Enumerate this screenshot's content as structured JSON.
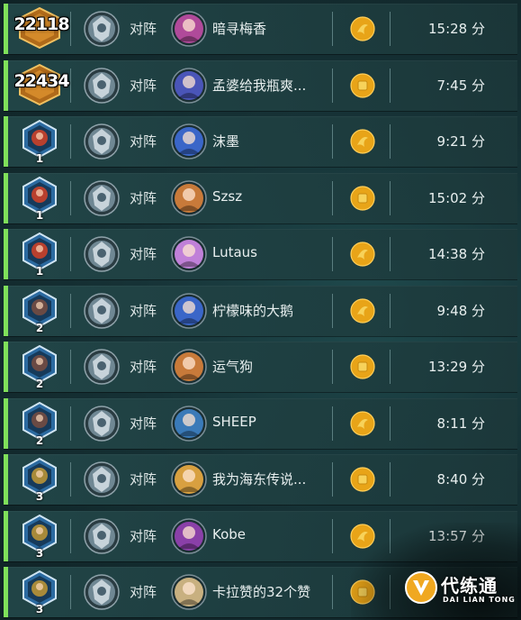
{
  "vs_label": "对阵",
  "matches": [
    {
      "rank_type": "legend",
      "rank_value": "22118",
      "opponent": "暗寻梅香",
      "first": false,
      "duration": "15:28 分",
      "opp_color": "#b04a9a"
    },
    {
      "rank_type": "legend",
      "rank_value": "22434",
      "opponent": "孟婆给我瓶爽...",
      "first": true,
      "duration": "7:45 分",
      "opp_color": "#4a55b8"
    },
    {
      "rank_type": "tier",
      "rank_value": "1",
      "tier": "red",
      "opponent": "沫墨",
      "first": false,
      "duration": "9:21 分",
      "opp_color": "#3a66c8"
    },
    {
      "rank_type": "tier",
      "rank_value": "1",
      "tier": "red",
      "opponent": "Szsz",
      "first": true,
      "duration": "15:02 分",
      "opp_color": "#c87a3a"
    },
    {
      "rank_type": "tier",
      "rank_value": "1",
      "tier": "red",
      "opponent": "Lutaus",
      "first": false,
      "duration": "14:38 分",
      "opp_color": "#c080d8"
    },
    {
      "rank_type": "tier",
      "rank_value": "2",
      "tier": "dark",
      "opponent": "柠檬味的大鹅",
      "first": false,
      "duration": "9:48 分",
      "opp_color": "#3a66c8"
    },
    {
      "rank_type": "tier",
      "rank_value": "2",
      "tier": "dark",
      "opponent": "运气狗",
      "first": true,
      "duration": "13:29 分",
      "opp_color": "#c87a3a"
    },
    {
      "rank_type": "tier",
      "rank_value": "2",
      "tier": "dark",
      "opponent": "SHEEP",
      "first": false,
      "duration": "8:11 分",
      "opp_color": "#3a7ab8"
    },
    {
      "rank_type": "tier",
      "rank_value": "3",
      "tier": "gold",
      "opponent": "我为海东传说...",
      "first": true,
      "duration": "8:40 分",
      "opp_color": "#d8a040"
    },
    {
      "rank_type": "tier",
      "rank_value": "3",
      "tier": "gold",
      "opponent": "Kobe",
      "first": false,
      "duration": "13:57 分",
      "opp_color": "#8a40a8"
    },
    {
      "rank_type": "tier",
      "rank_value": "3",
      "tier": "gold",
      "opponent": "卡拉赞的32个赞",
      "first": true,
      "duration": "",
      "opp_color": "#c8b080"
    }
  ],
  "watermark": {
    "name": "代练通",
    "sub": "DAI LIAN TONG"
  }
}
